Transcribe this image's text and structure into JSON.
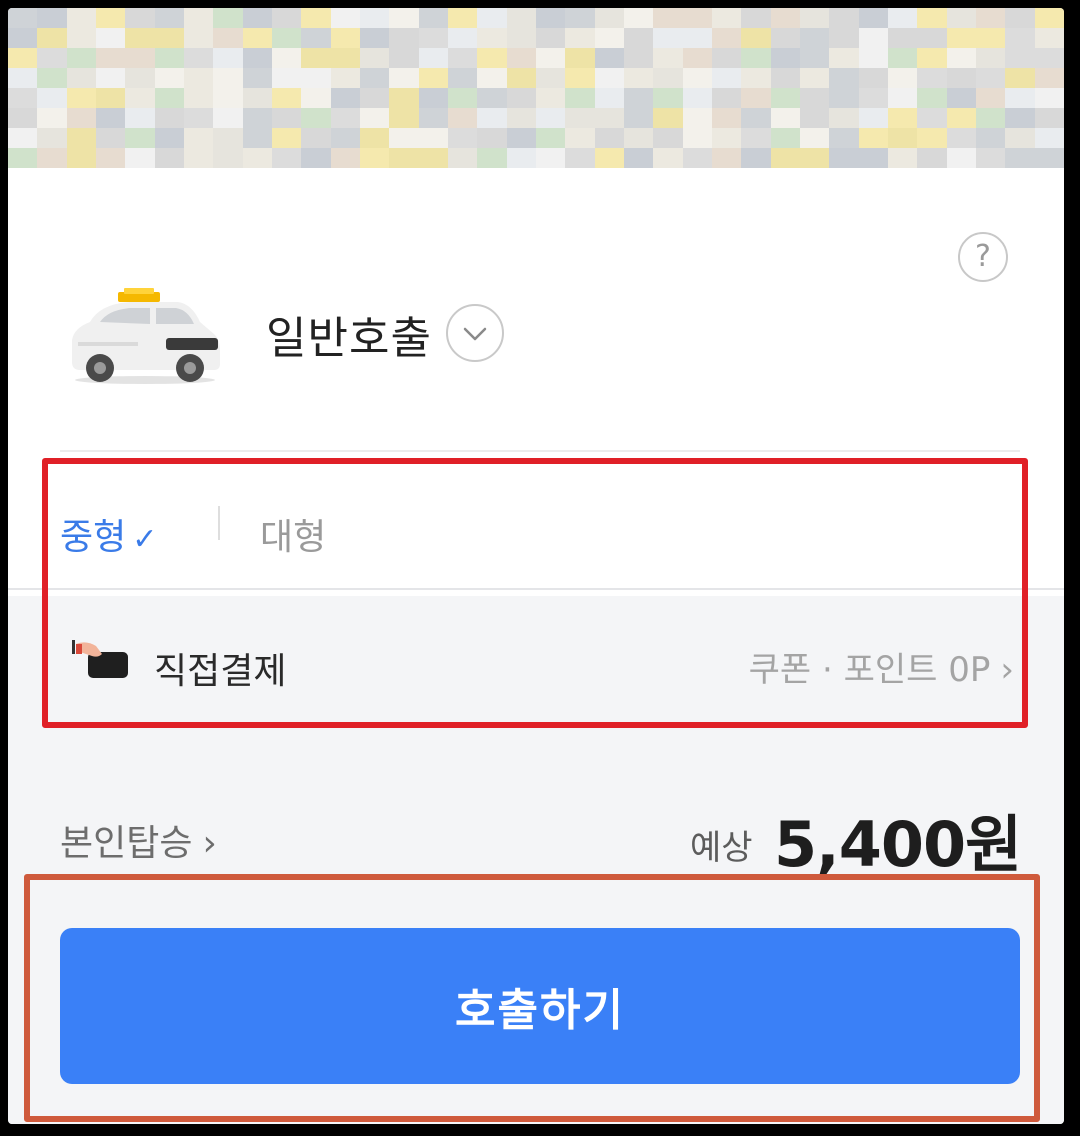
{
  "help": {
    "symbol": "?"
  },
  "service": {
    "title": "일반호출"
  },
  "size_tabs": [
    {
      "label": "중형",
      "selected": true,
      "check": "✓"
    },
    {
      "label": "대형",
      "selected": false
    }
  ],
  "payment": {
    "method": "직접결제",
    "coupon_points": "쿠폰 · 포인트 0P",
    "chevron": "›"
  },
  "ride_option": {
    "label": "본인탑승",
    "chevron": "›"
  },
  "fare": {
    "prefix": "예상",
    "amount": "5,400원"
  },
  "call_button": {
    "label": "호출하기"
  },
  "colors": {
    "accent_blue": "#3a7be8",
    "button_blue": "#3a80f7",
    "highlight_red": "#e02027",
    "highlight_orange": "#cf5a3c"
  }
}
